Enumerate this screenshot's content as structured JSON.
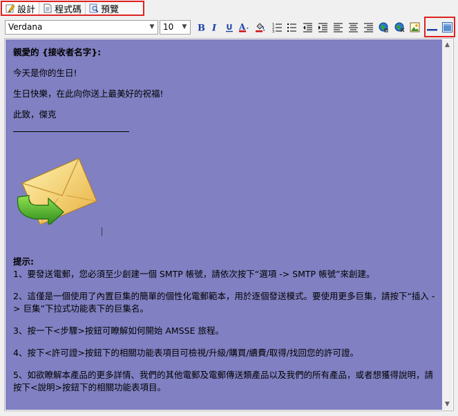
{
  "tabs": [
    {
      "label": "設計",
      "icon": "design-pencil-icon",
      "active": true
    },
    {
      "label": "程式碼",
      "icon": "code-page-icon",
      "active": false
    },
    {
      "label": "預覽",
      "icon": "preview-magnifier-icon",
      "active": false
    }
  ],
  "toolbar": {
    "font_family": "Verdana",
    "font_size": "10"
  },
  "colors": {
    "editor_bg": "#8080c2",
    "highlight_red": "#e02020"
  },
  "email": {
    "greeting": "親愛的 {接收者名字}:",
    "line1": "今天是你的生日!",
    "line2": "生日快樂，在此向你送上最美好的祝福!",
    "signoff": "此致，傑克",
    "tips_title": "提示:",
    "tip1": "1、要發送電郵，您必須至少創建一個 SMTP 帳號，請依次按下“選項 -> SMTP 帳號”來創建。",
    "tip2": "2、這僅是一個使用了內置巨集的簡單的個性化電郵範本，用於逐個發送模式。要使用更多巨集，請按下“插入 -> 巨集”下拉式功能表下的巨集名。",
    "tip3": "3、按一下<步驟>按鈕可瞭解如何開始 AMSSE 旅程。",
    "tip4": "4、按下<許可證>按鈕下的相關功能表項目可檢視/升級/購買/續費/取得/找回您的許可證。",
    "tip5": "5、如欲瞭解本產品的更多詳情、我們的其他電郵及電郵傳送類產品以及我們的所有產品，或者想獲得說明，請按下<說明>按鈕下的相關功能表項目。"
  }
}
